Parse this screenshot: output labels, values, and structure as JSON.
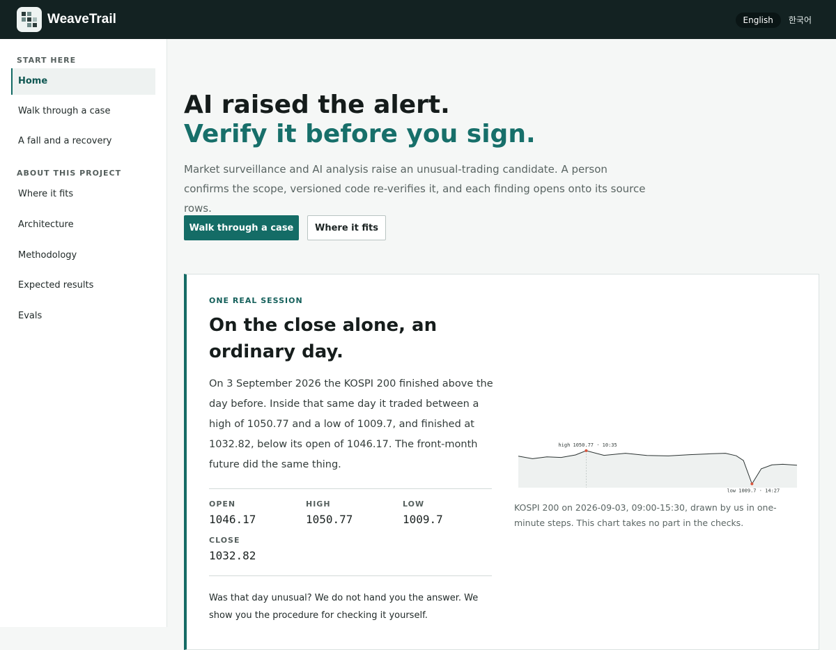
{
  "app": {
    "name": "WeaveTrail",
    "languages": [
      "English",
      "한국어"
    ],
    "active_language": "English"
  },
  "sidebar": {
    "sections": [
      {
        "title": "START HERE",
        "items": [
          {
            "label": "Home",
            "active": true
          },
          {
            "label": "Walk through a case"
          },
          {
            "label": "A fall and a recovery"
          }
        ]
      },
      {
        "title": "ABOUT THIS PROJECT",
        "items": [
          {
            "label": "Where it fits"
          },
          {
            "label": "Architecture"
          },
          {
            "label": "Methodology"
          },
          {
            "label": "Expected results"
          },
          {
            "label": "Evals"
          }
        ]
      }
    ]
  },
  "hero": {
    "title_line1": "AI raised the alert.",
    "title_line2": "Verify it before you sign.",
    "lead": "Market surveillance and AI analysis raise an unusual-trading candidate. A person confirms the scope, versioned code re-verifies it, and each finding opens onto its source rows.",
    "primary_button": "Walk through a case",
    "secondary_button": "Where it fits"
  },
  "session": {
    "kicker": "ONE REAL SESSION",
    "title": "On the close alone, an ordinary day.",
    "body": "On 3 September 2026 the KOSPI 200 finished above the day before. Inside that same day it traded between a high of 1050.77 and a low of 1009.7, and finished at 1032.82, below its open of 1046.17. The front-month future did the same thing.",
    "stats": [
      {
        "label": "OPEN",
        "value": "1046.17"
      },
      {
        "label": "HIGH",
        "value": "1050.77"
      },
      {
        "label": "LOW",
        "value": "1009.7"
      },
      {
        "label": "CLOSE",
        "value": "1032.82"
      }
    ],
    "question": "Was that day unusual? We do not hand you the answer. We show you the procedure for checking it yourself.",
    "chart_caption": "KOSPI 200 on 2026-09-03, 09:00-15:30, drawn by us in one-minute steps. This chart takes no part in the checks."
  },
  "colors": {
    "accent": "#146c66",
    "topbar": "#132222",
    "marker": "#d9553d"
  },
  "chart_data": {
    "type": "line",
    "title": "",
    "xlabel": "",
    "ylabel": "",
    "x": [
      "09:00",
      "09:20",
      "09:40",
      "10:00",
      "10:20",
      "10:35",
      "11:00",
      "11:30",
      "12:00",
      "12:30",
      "13:00",
      "13:30",
      "13:50",
      "14:05",
      "14:15",
      "14:27",
      "14:40",
      "14:55",
      "15:10",
      "15:30"
    ],
    "series": [
      {
        "values": [
          1044.0,
          1040.9,
          1043.2,
          1042.4,
          1045.5,
          1050.77,
          1045.0,
          1047.6,
          1044.8,
          1044.3,
          1045.9,
          1047.0,
          1047.6,
          1044.5,
          1038.6,
          1009.7,
          1028.4,
          1033.2,
          1034.0,
          1032.82
        ]
      }
    ],
    "annotations": [
      {
        "label": "high 1050.77 · 10:35",
        "x": "10:35",
        "y": 1050.77
      },
      {
        "label": "low 1009.7 · 14:27",
        "x": "14:27",
        "y": 1009.7
      }
    ],
    "ylim": [
      1005,
      1055
    ],
    "grid": false
  }
}
